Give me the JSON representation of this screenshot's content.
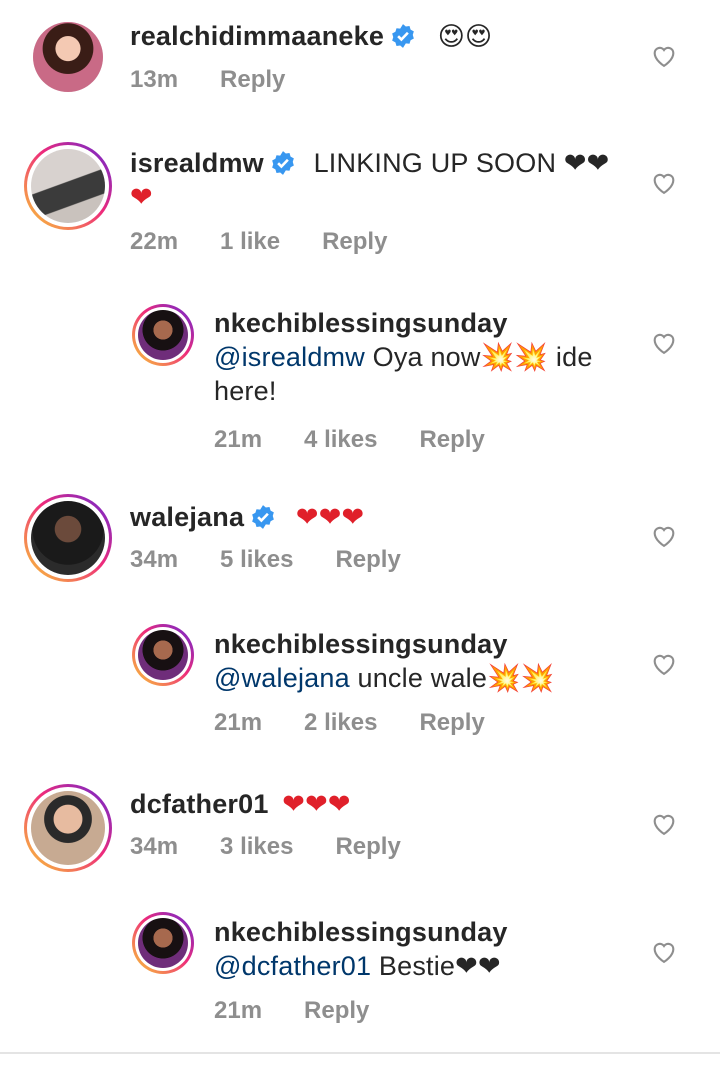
{
  "comments": [
    {
      "username": "realchidimmaaneke",
      "verified": true,
      "text": "😍😍",
      "time": "13m",
      "likes": "",
      "reply_label": "Reply"
    },
    {
      "username": "isrealdmw",
      "verified": true,
      "text": "LINKING UP SOON ❤❤",
      "text2": "❤",
      "time": "22m",
      "likes": "1 like",
      "reply_label": "Reply"
    },
    {
      "username": "nkechiblessingsunday",
      "mention": "@isrealdmw",
      "text": " Oya now💥💥 ide",
      "text2": "here!",
      "time": "21m",
      "likes": "4 likes",
      "reply_label": "Reply"
    },
    {
      "username": "walejana",
      "verified": true,
      "text": "❤❤❤",
      "time": "34m",
      "likes": "5 likes",
      "reply_label": "Reply"
    },
    {
      "username": "nkechiblessingsunday",
      "mention": "@walejana",
      "text": " uncle wale💥💥",
      "time": "21m",
      "likes": "2 likes",
      "reply_label": "Reply"
    },
    {
      "username": "dcfather01",
      "verified": false,
      "text": "❤❤❤",
      "time": "34m",
      "likes": "3 likes",
      "reply_label": "Reply"
    },
    {
      "username": "nkechiblessingsunday",
      "mention": "@dcfather01",
      "text": " Bestie❤❤",
      "time": "21m",
      "likes": "",
      "reply_label": "Reply"
    }
  ],
  "colors": {
    "username": "#262626",
    "meta": "#8e8e8e",
    "mention": "#00376b",
    "verified": "#3897f0",
    "heart": "#e0202a"
  },
  "icons": {
    "verified": "verified-badge-icon",
    "like": "heart-outline-icon"
  }
}
